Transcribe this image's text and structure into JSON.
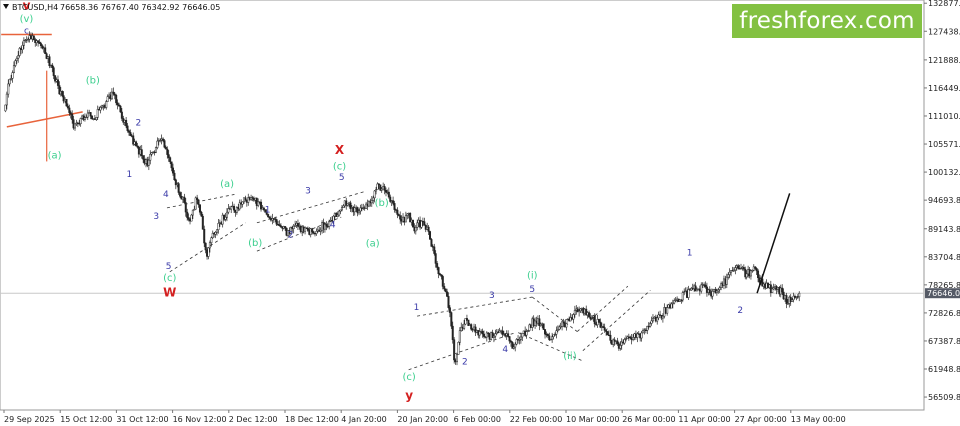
{
  "header": {
    "symbol": "BTCUSD,H4",
    "ohlc": "76658.36 76767.40 76342.92 76646.05"
  },
  "brand": {
    "text": "freshforex.com"
  },
  "colors": {
    "up": "#222222",
    "down": "#222222",
    "fib": "#e8633b",
    "wave_green": "#3ccf8e",
    "wave_blue": "#3a3aa8",
    "wave_red": "#d42020",
    "price_box": "#555a66"
  },
  "chart_data": {
    "type": "candlestick",
    "symbol": "BTCUSD",
    "timeframe": "H4",
    "current_price": 76646.05,
    "ylim": [
      54000,
      133500
    ],
    "y_ticks": [
      {
        "value": 132877.8,
        "label": "132877.80"
      },
      {
        "value": 127438.8,
        "label": "127438.80"
      },
      {
        "value": 121888.8,
        "label": "121888.80"
      },
      {
        "value": 116449.8,
        "label": "116449.80"
      },
      {
        "value": 111010.8,
        "label": "111010.80"
      },
      {
        "value": 105571.8,
        "label": "105571.80"
      },
      {
        "value": 100132.8,
        "label": "100132.80"
      },
      {
        "value": 94693.8,
        "label": "94693.80"
      },
      {
        "value": 89143.8,
        "label": "89143.80"
      },
      {
        "value": 83704.8,
        "label": "83704.80"
      },
      {
        "value": 78265.8,
        "label": "78265.80"
      },
      {
        "value": 72826.8,
        "label": "72826.80"
      },
      {
        "value": 67387.8,
        "label": "67387.80"
      },
      {
        "value": 61948.8,
        "label": "61948.80"
      },
      {
        "value": 56509.8,
        "label": "56509.80"
      }
    ],
    "x_ticks": [
      "29 Sep 2025",
      "15 Oct 12:00",
      "31 Oct 12:00",
      "16 Nov 12:00",
      "2 Dec 12:00",
      "18 Dec 12:00",
      "4 Jan 20:00",
      "20 Jan 20:00",
      "6 Feb 00:00",
      "22 Feb 00:00",
      "10 Mar 00:00",
      "26 Mar 00:00",
      "11 Apr 00:00",
      "27 Apr 00:00",
      "13 May 00:00"
    ],
    "path": [
      {
        "t": 0,
        "v": 112000
      },
      {
        "t": 0.1,
        "v": 118000
      },
      {
        "t": 0.3,
        "v": 124500
      },
      {
        "t": 0.5,
        "v": 126200
      },
      {
        "t": 0.7,
        "v": 124000
      },
      {
        "t": 0.85,
        "v": 120000
      },
      {
        "t": 1.0,
        "v": 115500
      },
      {
        "t": 1.15,
        "v": 112500
      },
      {
        "t": 1.25,
        "v": 109000
      },
      {
        "t": 1.45,
        "v": 111500
      },
      {
        "t": 1.6,
        "v": 110500
      },
      {
        "t": 1.8,
        "v": 113500
      },
      {
        "t": 1.93,
        "v": 115500
      },
      {
        "t": 2.1,
        "v": 111000
      },
      {
        "t": 2.25,
        "v": 107000
      },
      {
        "t": 2.45,
        "v": 103500
      },
      {
        "t": 2.55,
        "v": 101800
      },
      {
        "t": 2.7,
        "v": 105000
      },
      {
        "t": 2.78,
        "v": 107000
      },
      {
        "t": 2.92,
        "v": 103500
      },
      {
        "t": 3.05,
        "v": 98500
      },
      {
        "t": 3.2,
        "v": 94000
      },
      {
        "t": 3.3,
        "v": 90500
      },
      {
        "t": 3.42,
        "v": 95000
      },
      {
        "t": 3.5,
        "v": 92000
      },
      {
        "t": 3.6,
        "v": 84000
      },
      {
        "t": 3.7,
        "v": 87500
      },
      {
        "t": 3.85,
        "v": 90500
      },
      {
        "t": 4.0,
        "v": 92500
      },
      {
        "t": 4.15,
        "v": 93200
      },
      {
        "t": 4.3,
        "v": 95000
      },
      {
        "t": 4.45,
        "v": 94500
      },
      {
        "t": 4.6,
        "v": 93500
      },
      {
        "t": 4.75,
        "v": 91500
      },
      {
        "t": 4.9,
        "v": 89500
      },
      {
        "t": 5.05,
        "v": 88200
      },
      {
        "t": 5.2,
        "v": 89500
      },
      {
        "t": 5.35,
        "v": 89000
      },
      {
        "t": 5.5,
        "v": 88500
      },
      {
        "t": 5.65,
        "v": 89500
      },
      {
        "t": 5.8,
        "v": 90500
      },
      {
        "t": 5.95,
        "v": 92000
      },
      {
        "t": 6.1,
        "v": 94500
      },
      {
        "t": 6.25,
        "v": 92500
      },
      {
        "t": 6.4,
        "v": 93000
      },
      {
        "t": 6.55,
        "v": 95000
      },
      {
        "t": 6.65,
        "v": 97800
      },
      {
        "t": 6.8,
        "v": 96000
      },
      {
        "t": 6.95,
        "v": 93500
      },
      {
        "t": 7.05,
        "v": 90500
      },
      {
        "t": 7.2,
        "v": 91500
      },
      {
        "t": 7.3,
        "v": 89500
      },
      {
        "t": 7.45,
        "v": 90500
      },
      {
        "t": 7.55,
        "v": 88500
      },
      {
        "t": 7.65,
        "v": 84000
      },
      {
        "t": 7.75,
        "v": 80000
      },
      {
        "t": 7.88,
        "v": 76500
      },
      {
        "t": 7.96,
        "v": 70000
      },
      {
        "t": 8.02,
        "v": 62500
      },
      {
        "t": 8.1,
        "v": 68500
      },
      {
        "t": 8.2,
        "v": 71500
      },
      {
        "t": 8.3,
        "v": 70000
      },
      {
        "t": 8.5,
        "v": 69000
      },
      {
        "t": 8.7,
        "v": 68200
      },
      {
        "t": 8.85,
        "v": 69500
      },
      {
        "t": 9.05,
        "v": 66500
      },
      {
        "t": 9.25,
        "v": 69000
      },
      {
        "t": 9.4,
        "v": 71000
      },
      {
        "t": 9.5,
        "v": 71500
      },
      {
        "t": 9.65,
        "v": 68500
      },
      {
        "t": 9.75,
        "v": 67500
      },
      {
        "t": 9.9,
        "v": 70000
      },
      {
        "t": 10.05,
        "v": 71500
      },
      {
        "t": 10.25,
        "v": 73800
      },
      {
        "t": 10.4,
        "v": 72500
      },
      {
        "t": 10.55,
        "v": 71000
      },
      {
        "t": 10.7,
        "v": 69500
      },
      {
        "t": 10.82,
        "v": 67000
      },
      {
        "t": 10.95,
        "v": 66500
      },
      {
        "t": 11.1,
        "v": 68500
      },
      {
        "t": 11.25,
        "v": 68000
      },
      {
        "t": 11.4,
        "v": 69500
      },
      {
        "t": 11.55,
        "v": 71500
      },
      {
        "t": 11.7,
        "v": 72500
      },
      {
        "t": 11.85,
        "v": 74500
      },
      {
        "t": 12.0,
        "v": 75500
      },
      {
        "t": 12.15,
        "v": 76500
      },
      {
        "t": 12.3,
        "v": 77500
      },
      {
        "t": 12.45,
        "v": 78000
      },
      {
        "t": 12.6,
        "v": 76500
      },
      {
        "t": 12.75,
        "v": 78000
      },
      {
        "t": 12.9,
        "v": 80000
      },
      {
        "t": 13.05,
        "v": 81500
      },
      {
        "t": 13.2,
        "v": 80500
      },
      {
        "t": 13.35,
        "v": 81000
      },
      {
        "t": 13.5,
        "v": 78500
      },
      {
        "t": 13.65,
        "v": 77500
      },
      {
        "t": 13.8,
        "v": 77200
      },
      {
        "t": 13.95,
        "v": 75000
      },
      {
        "t": 14.05,
        "v": 76500
      },
      {
        "t": 14.15,
        "v": 76646
      }
    ],
    "wave_labels": [
      {
        "text": "v",
        "t": 0.4,
        "v": 131700,
        "color": "red",
        "weight": "bold",
        "size": 12
      },
      {
        "text": "(v)",
        "t": 0.4,
        "v": 129200,
        "color": "green",
        "size": 10
      },
      {
        "text": "c",
        "t": 0.4,
        "v": 127000,
        "color": "blue",
        "size": 9
      },
      {
        "text": "(a)",
        "t": 0.9,
        "v": 102800,
        "color": "green",
        "size": 10
      },
      {
        "text": "(b)",
        "t": 1.58,
        "v": 117300,
        "color": "green",
        "size": 10
      },
      {
        "text": "2",
        "t": 2.39,
        "v": 109200,
        "color": "blue",
        "size": 9
      },
      {
        "text": "1",
        "t": 2.23,
        "v": 99200,
        "color": "blue",
        "size": 9
      },
      {
        "text": "4",
        "t": 2.88,
        "v": 95300,
        "color": "blue",
        "size": 9
      },
      {
        "text": "3",
        "t": 2.71,
        "v": 91000,
        "color": "blue",
        "size": 9
      },
      {
        "text": "5",
        "t": 2.93,
        "v": 81300,
        "color": "blue",
        "size": 9
      },
      {
        "text": "(c)",
        "t": 2.95,
        "v": 79000,
        "color": "green",
        "size": 10
      },
      {
        "text": "W",
        "t": 2.95,
        "v": 76000,
        "color": "red",
        "weight": "bold",
        "size": 12
      },
      {
        "text": "(a)",
        "t": 3.97,
        "v": 97200,
        "color": "green",
        "size": 10
      },
      {
        "text": "(b)",
        "t": 4.47,
        "v": 85800,
        "color": "green",
        "size": 10
      },
      {
        "text": "1",
        "t": 4.69,
        "v": 92300,
        "color": "blue",
        "size": 9
      },
      {
        "text": "2",
        "t": 5.1,
        "v": 87400,
        "color": "blue",
        "size": 9
      },
      {
        "text": "3",
        "t": 5.41,
        "v": 96000,
        "color": "blue",
        "size": 9
      },
      {
        "text": "4",
        "t": 5.85,
        "v": 89400,
        "color": "blue",
        "size": 9
      },
      {
        "text": "5",
        "t": 6.01,
        "v": 98600,
        "color": "blue",
        "size": 9
      },
      {
        "text": "(c)",
        "t": 5.97,
        "v": 100600,
        "color": "green",
        "size": 10
      },
      {
        "text": "X",
        "t": 5.97,
        "v": 103600,
        "color": "red",
        "weight": "bold",
        "size": 12
      },
      {
        "text": "(b)",
        "t": 6.72,
        "v": 93600,
        "color": "green",
        "size": 10
      },
      {
        "text": "(a)",
        "t": 6.56,
        "v": 85700,
        "color": "green",
        "size": 10
      },
      {
        "text": "1",
        "t": 7.34,
        "v": 73400,
        "color": "blue",
        "size": 9
      },
      {
        "text": "(c)",
        "t": 7.21,
        "v": 59800,
        "color": "green",
        "size": 10
      },
      {
        "text": "y",
        "t": 7.21,
        "v": 56000,
        "color": "red",
        "weight": "bold",
        "size": 12
      },
      {
        "text": "2",
        "t": 8.2,
        "v": 62800,
        "color": "blue",
        "size": 9
      },
      {
        "text": "3",
        "t": 8.68,
        "v": 75700,
        "color": "blue",
        "size": 9
      },
      {
        "text": "4",
        "t": 8.92,
        "v": 65200,
        "color": "blue",
        "size": 9
      },
      {
        "text": "5",
        "t": 9.4,
        "v": 76900,
        "color": "blue",
        "size": 9
      },
      {
        "text": "(i)",
        "t": 9.4,
        "v": 79500,
        "color": "green",
        "size": 10
      },
      {
        "text": "(ii)",
        "t": 10.07,
        "v": 63900,
        "color": "green",
        "size": 10
      },
      {
        "text": "1",
        "t": 12.2,
        "v": 84000,
        "color": "blue",
        "size": 9
      },
      {
        "text": "2",
        "t": 13.1,
        "v": 72800,
        "color": "blue",
        "size": 9
      }
    ],
    "channels": [
      {
        "p1": [
          2.9,
          93200
        ],
        "p2": [
          4.1,
          95800
        ]
      },
      {
        "p1": [
          2.95,
          80800
        ],
        "p2": [
          4.3,
          90300
        ]
      },
      {
        "p1": [
          4.5,
          90300
        ],
        "p2": [
          6.4,
          96300
        ]
      },
      {
        "p1": [
          4.5,
          84800
        ],
        "p2": [
          6.0,
          91400
        ]
      },
      {
        "p1": [
          7.35,
          72200
        ],
        "p2": [
          9.4,
          75900
        ]
      },
      {
        "p1": [
          7.2,
          61800
        ],
        "p2": [
          9.1,
          69000
        ]
      },
      {
        "p1": [
          9.4,
          75900
        ],
        "p2": [
          10.2,
          69200
        ]
      },
      {
        "p1": [
          9.15,
          69000
        ],
        "p2": [
          10.3,
          63500
        ]
      },
      {
        "p1": [
          10.2,
          69200
        ],
        "p2": [
          11.1,
          78000
        ]
      },
      {
        "p1": [
          10.3,
          65500
        ],
        "p2": [
          11.5,
          77200
        ]
      }
    ],
    "forecast": {
      "from": [
        13.4,
        76650
      ],
      "to": [
        13.98,
        96000
      ]
    },
    "fib_lines": [
      {
        "p1": [
          -0.05,
          126800
        ],
        "p2": [
          0.85,
          126800
        ]
      },
      {
        "p1": [
          0.05,
          108900
        ],
        "p2": [
          1.4,
          111800
        ]
      }
    ],
    "fib_vline": {
      "t": 0.76,
      "v_top": 119800,
      "v_bottom": 102200
    },
    "current_price_line": 76646.05
  }
}
